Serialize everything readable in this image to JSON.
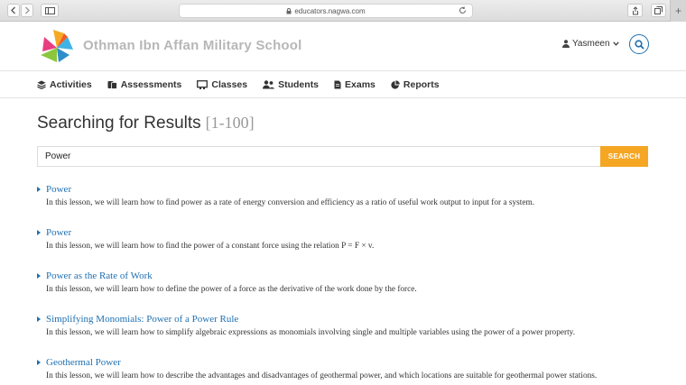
{
  "browser": {
    "url": "educators.nagwa.com"
  },
  "header": {
    "school_name": "Othman Ibn Affan Military School",
    "user_name": "Yasmeen"
  },
  "nav": {
    "items": [
      {
        "label": "Activities",
        "icon": "layers-icon"
      },
      {
        "label": "Assessments",
        "icon": "tasks-icon"
      },
      {
        "label": "Classes",
        "icon": "chalkboard-icon"
      },
      {
        "label": "Students",
        "icon": "users-icon"
      },
      {
        "label": "Exams",
        "icon": "document-icon"
      },
      {
        "label": "Reports",
        "icon": "pie-chart-icon"
      }
    ]
  },
  "main": {
    "title": "Searching for Results",
    "range": "[1-100]",
    "search": {
      "value": "Power",
      "button_label": "SEARCH"
    },
    "results": [
      {
        "title": "Power",
        "description": "In this lesson, we will learn how to find power as a rate of energy conversion and efficiency as a ratio of useful work output to input for a system."
      },
      {
        "title": "Power",
        "description": "In this lesson, we will learn how to find the power of a constant force using the relation P = F × v."
      },
      {
        "title": "Power as the Rate of Work",
        "description": "In this lesson, we will learn how to define the power of a force as the derivative of the work done by the force."
      },
      {
        "title": "Simplifying Monomials: Power of a Power Rule",
        "description": "In this lesson, we will learn how to simplify algebraic expressions as monomials involving single and multiple variables using the power of a power property."
      },
      {
        "title": "Geothermal Power",
        "description": "In this lesson, we will learn how to describe the advantages and disadvantages of geothermal power, and which locations are suitable for geothermal power stations."
      }
    ]
  },
  "colors": {
    "accent": "#f5a623",
    "link": "#1e6fb0",
    "school_name": "#b7b7b7"
  }
}
